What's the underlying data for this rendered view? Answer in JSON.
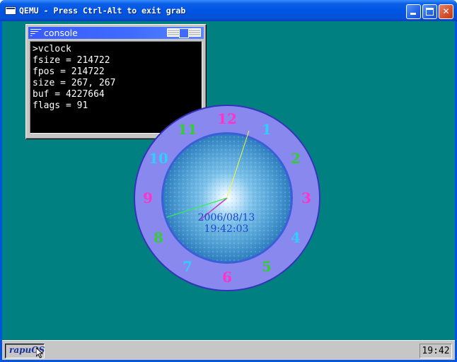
{
  "window": {
    "title": "QEMU - Press Ctrl-Alt to exit grab",
    "icon": "qemu-window-icon",
    "controls": [
      "minimize",
      "maximize",
      "close"
    ]
  },
  "desktop": {
    "background_color": "#008080"
  },
  "console": {
    "title": "console",
    "lines": [
      ">vclock",
      "fsize = 214722",
      "fpos = 214722",
      "size = 267, 267",
      "buf = 4227664",
      "flags = 91"
    ]
  },
  "clock": {
    "numerals": [
      {
        "label": "12",
        "color": "#ff33cc"
      },
      {
        "label": "1",
        "color": "#33ccff"
      },
      {
        "label": "2",
        "color": "#33cc33"
      },
      {
        "label": "3",
        "color": "#ff33cc"
      },
      {
        "label": "4",
        "color": "#33ccff"
      },
      {
        "label": "5",
        "color": "#33cc33"
      },
      {
        "label": "6",
        "color": "#ff33cc"
      },
      {
        "label": "7",
        "color": "#33ccff"
      },
      {
        "label": "8",
        "color": "#33cc33"
      },
      {
        "label": "9",
        "color": "#ff33cc"
      },
      {
        "label": "10",
        "color": "#33ccff"
      },
      {
        "label": "11",
        "color": "#33cc33"
      }
    ],
    "date": "2006/08/13",
    "time": "19:42:03",
    "hands": {
      "hour": 19,
      "minute": 42,
      "second": 3
    },
    "ring_color": "#8888ee",
    "face_color": "#5aa8d8"
  },
  "taskbar": {
    "start_label": "rapuOS",
    "clock": "19:42"
  }
}
